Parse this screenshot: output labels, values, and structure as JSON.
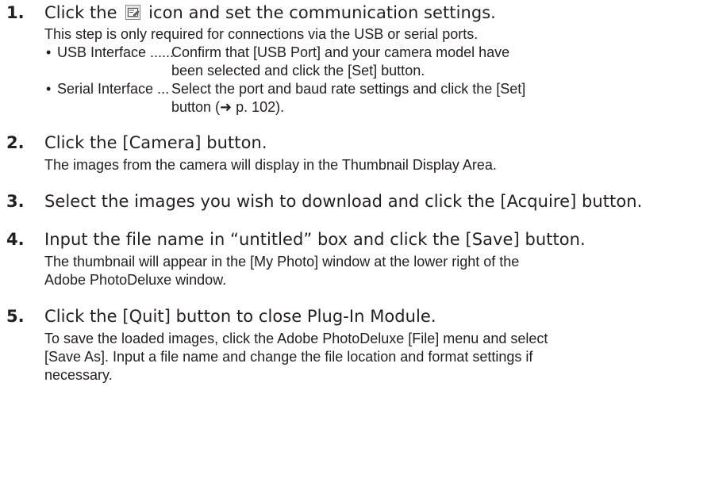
{
  "steps": [
    {
      "number": "1.",
      "heading_before_icon": "Click the",
      "icon": "communication-settings-icon",
      "heading_after_icon": "icon and set the communication settings.",
      "body": "This step is only required for connections via the USB or serial ports.",
      "bullets": [
        {
          "mark": "•",
          "term": "USB Interface ......",
          "desc": "Confirm that [USB Port] and your camera model have been selected and click the [Set] button."
        },
        {
          "mark": "•",
          "term": "Serial Interface ...",
          "desc": "Select the port and baud rate settings and click the [Set] button (➜ p. 102)."
        }
      ]
    },
    {
      "number": "2.",
      "heading": "Click the [Camera] button.",
      "body": "The images from the camera will display in the Thumbnail Display Area."
    },
    {
      "number": "3.",
      "heading": "Select the images you wish to download and click the [Acquire] button."
    },
    {
      "number": "4.",
      "heading": "Input the file name in “untitled” box and click the [Save] button.",
      "body_lines": [
        "The thumbnail will appear in the [My Photo] window at the lower right of the",
        "Adobe PhotoDeluxe window."
      ]
    },
    {
      "number": "5.",
      "heading": "Click the [Quit] button to close Plug-In Module.",
      "body_lines": [
        "To save the loaded images, click the Adobe PhotoDeluxe [File] menu and select",
        "[Save As]. Input a file name and change the file location and format settings if",
        "necessary."
      ]
    }
  ]
}
